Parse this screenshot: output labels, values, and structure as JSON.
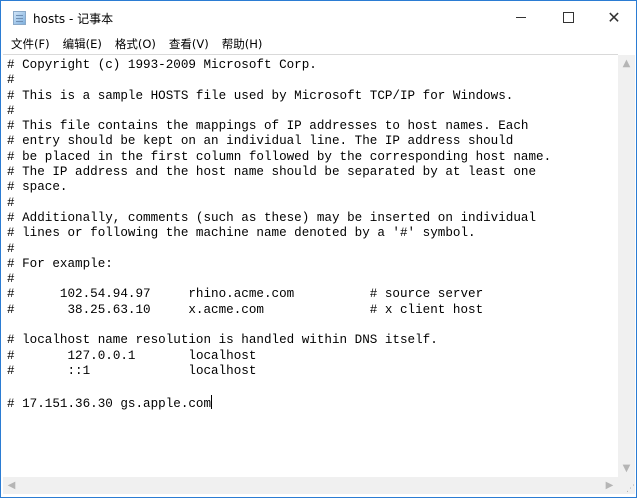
{
  "window": {
    "title": "hosts - 记事本",
    "controls": {
      "minimize": "minimize",
      "maximize": "maximize",
      "close": "close"
    }
  },
  "menu": [
    {
      "label": "文件(F)"
    },
    {
      "label": "编辑(E)"
    },
    {
      "label": "格式(O)"
    },
    {
      "label": "查看(V)"
    },
    {
      "label": "帮助(H)"
    }
  ],
  "editor": {
    "lines": [
      "# Copyright (c) 1993-2009 Microsoft Corp.",
      "#",
      "# This is a sample HOSTS file used by Microsoft TCP/IP for Windows.",
      "#",
      "# This file contains the mappings of IP addresses to host names. Each",
      "# entry should be kept on an individual line. The IP address should",
      "# be placed in the first column followed by the corresponding host name.",
      "# The IP address and the host name should be separated by at least one",
      "# space.",
      "#",
      "# Additionally, comments (such as these) may be inserted on individual",
      "# lines or following the machine name denoted by a '#' symbol.",
      "#",
      "# For example:",
      "#",
      "#      102.54.94.97     rhino.acme.com          # source server",
      "#       38.25.63.10     x.acme.com              # x client host",
      "",
      "# localhost name resolution is handled within DNS itself.",
      "#\t127.0.0.1       localhost",
      "#\t::1             localhost",
      "",
      "# 17.151.36.30 gs.apple.com"
    ],
    "caret_line": 22
  },
  "scrollbars": {
    "up": "▲",
    "down": "▼",
    "left": "◀",
    "right": "▶",
    "grip": "⋰"
  }
}
